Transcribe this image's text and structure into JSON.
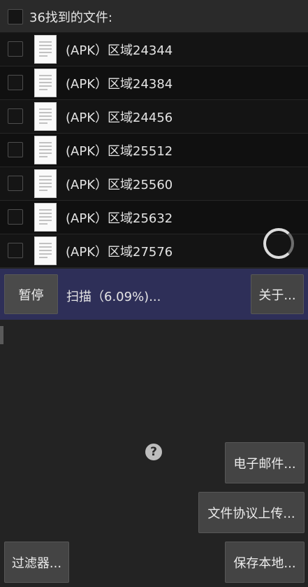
{
  "header": {
    "title": "36找到的文件:"
  },
  "files": [
    {
      "label": "(APK）区域24344"
    },
    {
      "label": "(APK）区域24384"
    },
    {
      "label": "(APK）区域24456"
    },
    {
      "label": "(APK）区域25512"
    },
    {
      "label": "(APK）区域25560"
    },
    {
      "label": "(APK）区域25632"
    },
    {
      "label": "(APK）区域27576"
    }
  ],
  "status": {
    "pause_label": "暂停",
    "scan_text": "扫描（6.09%)...",
    "scan_progress_percent": 6.09,
    "about_label": "关于..."
  },
  "actions": {
    "help_icon": "?",
    "email_label": "电子邮件...",
    "ftp_label": "文件协议上传...",
    "filter_label": "过滤器...",
    "save_label": "保存本地..."
  },
  "colors": {
    "background": "#232323",
    "list_background": "#141414",
    "status_bar": "#2e2f58",
    "button": "#444444"
  }
}
